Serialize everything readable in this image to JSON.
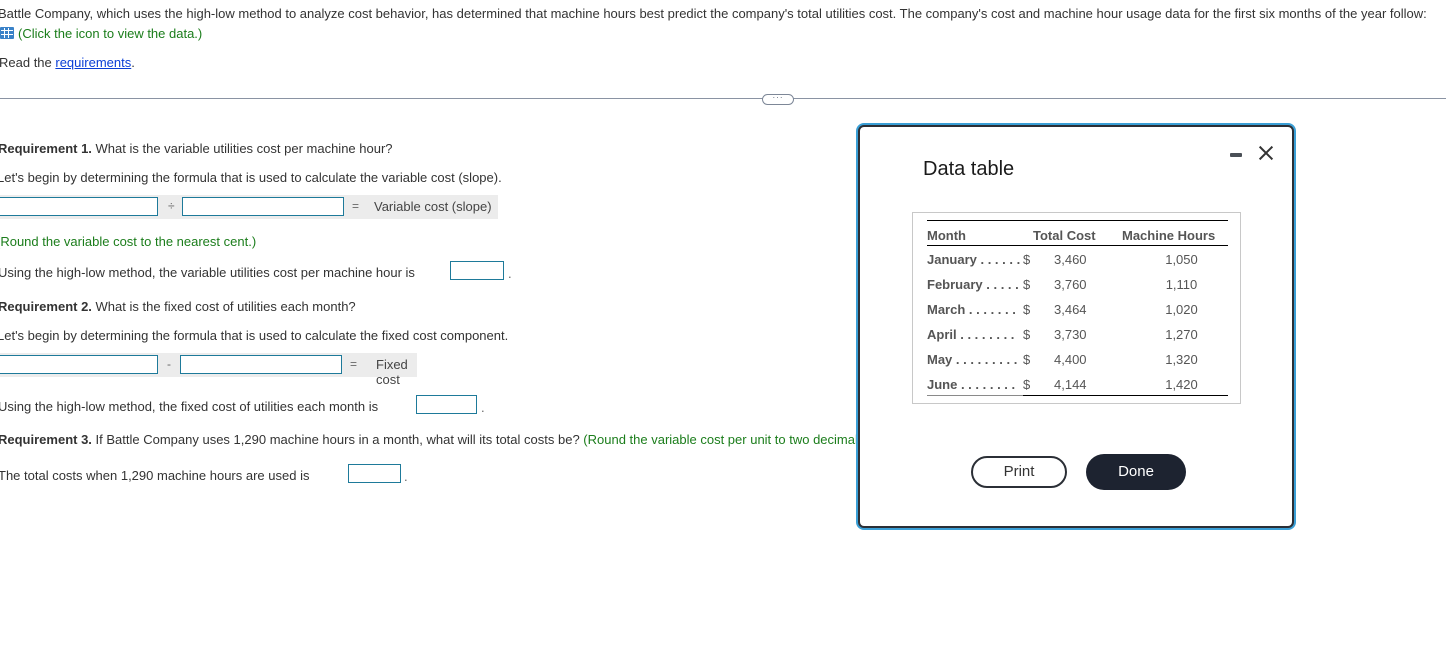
{
  "intro": {
    "text": "Battle Company, which uses the high-low method to analyze cost behavior, has determined that machine hours best predict the company's total utilities cost. The company's cost and machine hour usage data for the first six months of the year follow:",
    "data_icon": "grid-table-icon",
    "data_link_text": "(Click the icon to view the data.)",
    "read_prefix": "Read the ",
    "requirements_link": "requirements",
    "read_suffix": "."
  },
  "divider": {
    "more_label": "···"
  },
  "req1": {
    "label": "Requirement 1.",
    "question": " What is the variable utilities cost per machine hour?",
    "intro": "Let's begin by determining the formula that is used to calculate the variable cost (slope).",
    "operator": "÷",
    "equals": "=",
    "result_label": "Variable cost (slope)",
    "input1_value": "",
    "input2_value": "",
    "rounding_note": "(Round the variable cost to the nearest cent.)",
    "answer_prompt": "Using the high-low method, the variable utilities cost per machine hour is",
    "answer_value": "",
    "period": "."
  },
  "req2": {
    "label": "Requirement 2.",
    "question": " What is the fixed cost of utilities each month?",
    "intro": "Let's begin by determining the formula that is used to calculate the fixed cost component.",
    "operator": "-",
    "equals": "=",
    "result_label": "Fixed cost",
    "input1_value": "",
    "input2_value": "",
    "answer_prompt": "Using the high-low method, the fixed cost of utilities each month is",
    "answer_value": "",
    "period": "."
  },
  "req3": {
    "label": "Requirement 3.",
    "question": " If Battle Company uses 1,290 machine hours in a month, what will its total costs be?",
    "note": " (Round the variable cost per unit to two decimal",
    "answer_prompt": "The total costs when 1,290 machine hours are used is",
    "answer_value": "",
    "period": "."
  },
  "modal": {
    "title": "Data table",
    "minimize_icon": "minimize-icon",
    "close_icon": "close-icon",
    "columns": [
      "Month",
      "Total Cost",
      "Machine Hours"
    ],
    "rows": [
      {
        "month": "January . . . . . .",
        "currency": "$",
        "total_cost": "3,460",
        "machine_hours": "1,050"
      },
      {
        "month": "February . . . . .",
        "currency": "$",
        "total_cost": "3,760",
        "machine_hours": "1,110"
      },
      {
        "month": "March . . . . . . .",
        "currency": "$",
        "total_cost": "3,464",
        "machine_hours": "1,020"
      },
      {
        "month": "April . . . . . . . .",
        "currency": "$",
        "total_cost": "3,730",
        "machine_hours": "1,270"
      },
      {
        "month": "May . . . . . . . . .",
        "currency": "$",
        "total_cost": "4,400",
        "machine_hours": "1,320"
      },
      {
        "month": "June . . . . . . . .",
        "currency": "$",
        "total_cost": "4,144",
        "machine_hours": "1,420"
      }
    ],
    "print_label": "Print",
    "done_label": "Done"
  },
  "colors": {
    "green_note": "#1b7d1b",
    "input_border": "#1e7a9a",
    "modal_accent": "#3a9fd6",
    "done_bg": "#1d2330"
  }
}
